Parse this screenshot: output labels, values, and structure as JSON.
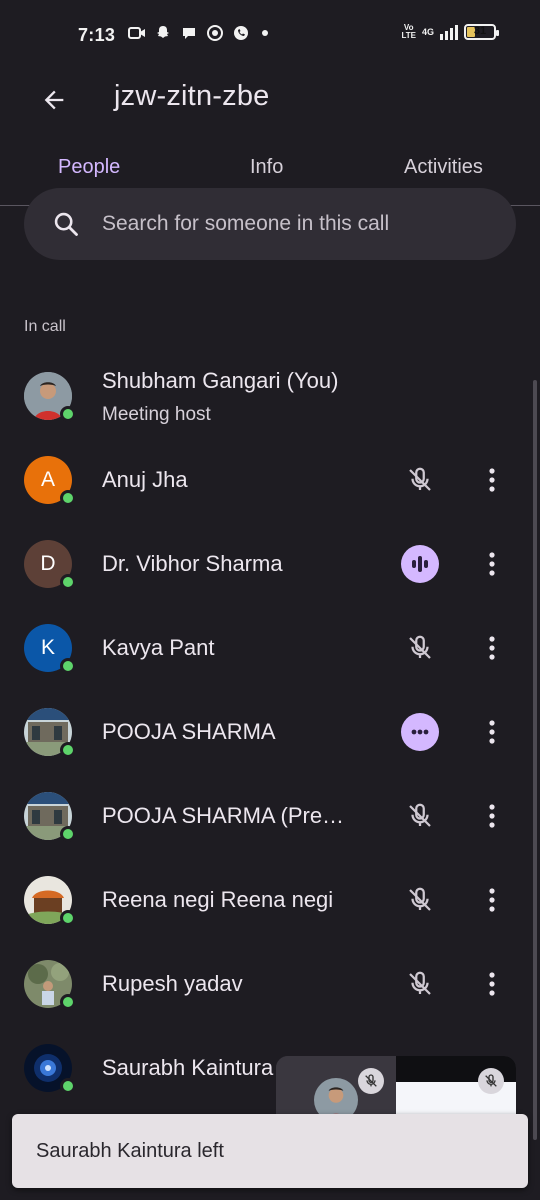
{
  "status_bar": {
    "time": "7:13",
    "network": "4G",
    "volte": "Vo LTE",
    "battery": "31",
    "battery_level_percent": 31
  },
  "app_bar": {
    "title": "jzw-zitn-zbe"
  },
  "tabs": [
    {
      "label": "People",
      "active": true
    },
    {
      "label": "Info",
      "active": false
    },
    {
      "label": "Activities",
      "active": false
    }
  ],
  "search": {
    "placeholder": "Search for someone in this call"
  },
  "section": {
    "label": "In call"
  },
  "participants": [
    {
      "name": "Shubham Gangari (You)",
      "subtitle": "Meeting host",
      "avatar": "photo",
      "initial": "",
      "avatar_color": "#6d7b86",
      "status": "none"
    },
    {
      "name": "Anuj Jha",
      "avatar": "initial",
      "initial": "A",
      "avatar_color": "#e8710a",
      "status": "muted"
    },
    {
      "name": "Dr. Vibhor Sharma",
      "avatar": "initial",
      "initial": "D",
      "avatar_color": "#5d4037",
      "status": "speaking"
    },
    {
      "name": "Kavya Pant",
      "avatar": "initial",
      "initial": "K",
      "avatar_color": "#0b57a8",
      "status": "muted"
    },
    {
      "name": "POOJA SHARMA",
      "avatar": "photo",
      "initial": "",
      "avatar_color": "#7c8a8f",
      "status": "presenting"
    },
    {
      "name": "POOJA SHARMA (Pre…",
      "avatar": "photo",
      "initial": "",
      "avatar_color": "#7c8a8f",
      "status": "muted"
    },
    {
      "name": "Reena negi Reena negi",
      "avatar": "photo",
      "initial": "",
      "avatar_color": "#c66a2b",
      "status": "muted"
    },
    {
      "name": "Rupesh yadav",
      "avatar": "photo",
      "initial": "",
      "avatar_color": "#6f7f5b",
      "status": "muted"
    },
    {
      "name": "Saurabh Kaintura",
      "avatar": "photo",
      "initial": "",
      "avatar_color": "#0b1b3a",
      "status": "none"
    }
  ],
  "snackbar": {
    "message": "Saurabh Kaintura left"
  },
  "colors": {
    "accent": "#d4b8ff",
    "background": "#1e1c22",
    "presence": "#5ed46b"
  }
}
